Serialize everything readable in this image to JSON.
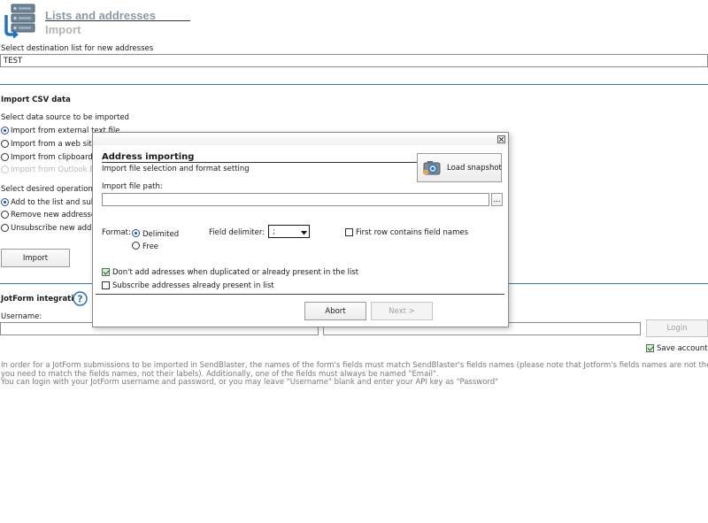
{
  "header": {
    "title": "Lists and addresses",
    "subtitle": "Import"
  },
  "destination": {
    "label": "Select destination list for new addresses",
    "value": "TEST"
  },
  "csv": {
    "title": "Import CSV data",
    "source_label": "Select data source to be imported",
    "sources": [
      {
        "label": "Import from external text file",
        "selected": true,
        "disabled": false
      },
      {
        "label": "Import from a web site vi",
        "selected": false,
        "disabled": false
      },
      {
        "label": "Import from clipboard",
        "selected": false,
        "disabled": false
      },
      {
        "label": "Import from Outlook Exp",
        "selected": false,
        "disabled": true
      }
    ],
    "operation_label": "Select desired operation",
    "operations": [
      {
        "label": "Add to the list and subsc",
        "selected": true
      },
      {
        "label": "Remove new addresses f",
        "selected": false
      },
      {
        "label": "Unsubscribe new addres",
        "selected": false
      }
    ],
    "import_button": "Import"
  },
  "jotform": {
    "title": "JotForm integration",
    "help_icon": "question-circle-icon",
    "username_label": "Username:",
    "login_button": "Login",
    "save_account_label": "Save account",
    "save_account_checked": true,
    "info_line1": "In order for a JotForm submissions to be imported in SendBlaster, the names of the form's fields must match SendBlaster's fields names (please note that Jotform's fields names are not the same thing as their labels:",
    "info_line2": "you need to match the fields names, not their labels). Additionally, one of the fields must always be named \"Email\".",
    "info_line3": "You can login with your JotForm username and password, or you may leave \"Username\" blank and enter your API key as \"Password\""
  },
  "dialog": {
    "close_icon": "close-icon",
    "title": "Address importing",
    "subtitle": "Import file selection and format setting",
    "load_snapshot": "Load snapshot",
    "file_path_label": "Import file path:",
    "browse_label": "...",
    "format_label": "Format:",
    "format_delimited": "Delimited",
    "format_free": "Free",
    "delimiter_label": "Field delimiter:",
    "delimiter_value": ";",
    "first_row_label": "First row contains field names",
    "dont_add_dup_label": "Don't add adresses when duplicated or already present in the list",
    "subscribe_label": "Subscribe addresses already present in list",
    "abort_button": "Abort",
    "next_button": "Next >"
  },
  "colors": {
    "accent_rule": "#3a78c2",
    "header_title": "#8a9aa8",
    "dialog_border": "#8a8a8a"
  }
}
